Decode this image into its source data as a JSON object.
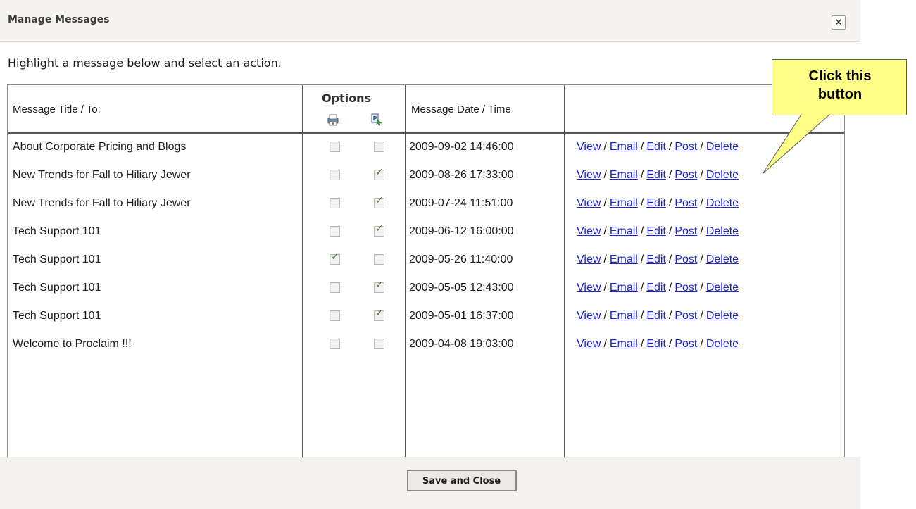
{
  "dialog": {
    "title": "Manage Messages",
    "close_label": "×",
    "instruction": "Highlight a message below and select an action."
  },
  "table": {
    "headers": {
      "title": "Message Title / To:",
      "options": "Options",
      "date": "Message Date / Time"
    },
    "option_icons": [
      "print-icon",
      "publish-icon"
    ],
    "rows": [
      {
        "title": "About Corporate Pricing and Blogs",
        "print": false,
        "publish": false,
        "date": "2009-09-02 14:46:00"
      },
      {
        "title": "New Trends for Fall to Hiliary Jewer",
        "print": false,
        "publish": true,
        "date": "2009-08-26 17:33:00"
      },
      {
        "title": "New Trends for Fall to Hiliary Jewer",
        "print": false,
        "publish": true,
        "date": "2009-07-24 11:51:00"
      },
      {
        "title": "Tech Support 101",
        "print": false,
        "publish": true,
        "date": "2009-06-12 16:00:00"
      },
      {
        "title": "Tech Support 101",
        "print": true,
        "publish": false,
        "date": "2009-05-26 11:40:00"
      },
      {
        "title": "Tech Support 101",
        "print": false,
        "publish": true,
        "date": "2009-05-05 12:43:00"
      },
      {
        "title": "Tech Support 101",
        "print": false,
        "publish": true,
        "date": "2009-05-01 16:37:00"
      },
      {
        "title": "Welcome to Proclaim !!!",
        "print": false,
        "publish": false,
        "date": "2009-04-08 19:03:00"
      }
    ],
    "actions": [
      "View",
      "Email",
      "Edit",
      "Post",
      "Delete"
    ],
    "action_separator": "/"
  },
  "footer": {
    "save_label": "Save and Close"
  },
  "callout": {
    "line1": "Click this",
    "line2": "button"
  },
  "colors": {
    "link": "#1a24d1",
    "callout_bg": "#ffff88",
    "checkmark": "#3a7a2a"
  }
}
